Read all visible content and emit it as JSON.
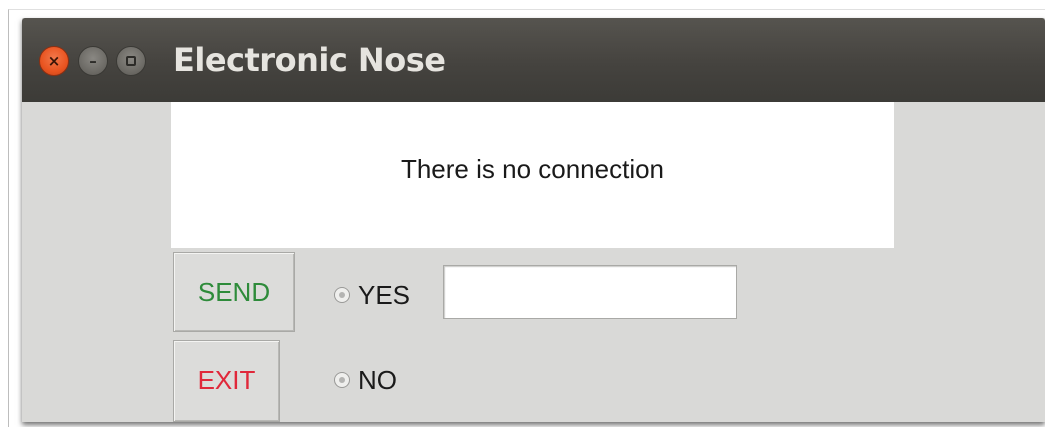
{
  "window": {
    "title": "Electronic Nose",
    "close_glyph": "×",
    "minimize_glyph": "–",
    "close_color": "#e95420",
    "titlebar_color": "#3c3b37"
  },
  "status": {
    "message": "There is no connection"
  },
  "buttons": {
    "send_label": "SEND",
    "send_color": "#2e8b3a",
    "exit_label": "EXIT",
    "exit_color": "#e0283a"
  },
  "options": {
    "yes_label": "YES",
    "no_label": "NO"
  },
  "input": {
    "value": "",
    "placeholder": ""
  },
  "icons": {
    "close": "close-icon",
    "minimize": "minimize-icon",
    "maximize": "maximize-icon",
    "radio": "radio-icon"
  }
}
